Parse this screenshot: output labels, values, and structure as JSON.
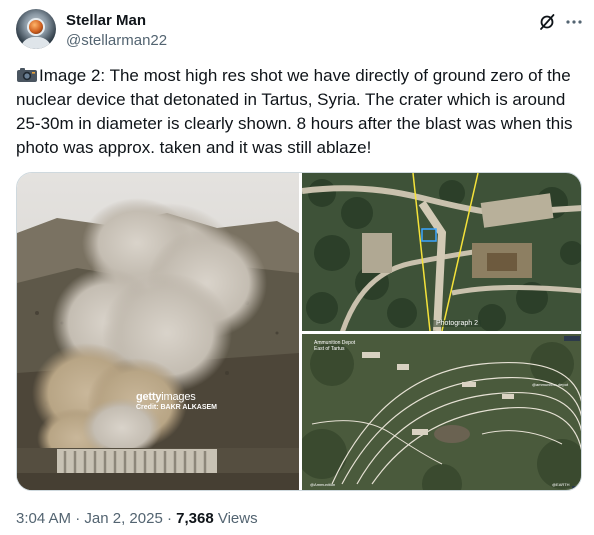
{
  "author": {
    "name": "Stellar Man",
    "handle": "@stellarman22"
  },
  "tweet": {
    "text": "Image 2: The most high res shot we have directly of ground zero of the nuclear device that detonated in Tartus, Syria. The crater which is around 25-30m in diameter is clearly shown. 8 hours after the blast was when this photo was approx. taken and it was still ablaze!"
  },
  "media": {
    "watermark_logo": "gettyimages",
    "watermark_credit": "Credit: BAKR ALKASEM",
    "top_right_label": "Photograph 2",
    "map_label": "Ammunition Depot\nEast of Tartus"
  },
  "footer": {
    "time": "3:04 AM",
    "separator": "·",
    "date": "Jan 2, 2025",
    "views_count": "7,368",
    "views_label": "Views"
  },
  "icons": {
    "grok": "grok-icon",
    "more": "more-dots-icon",
    "camera": "camera-emoji"
  },
  "colors": {
    "text_primary": "#0f1419",
    "text_secondary": "#536471",
    "border": "#cfd9de"
  }
}
